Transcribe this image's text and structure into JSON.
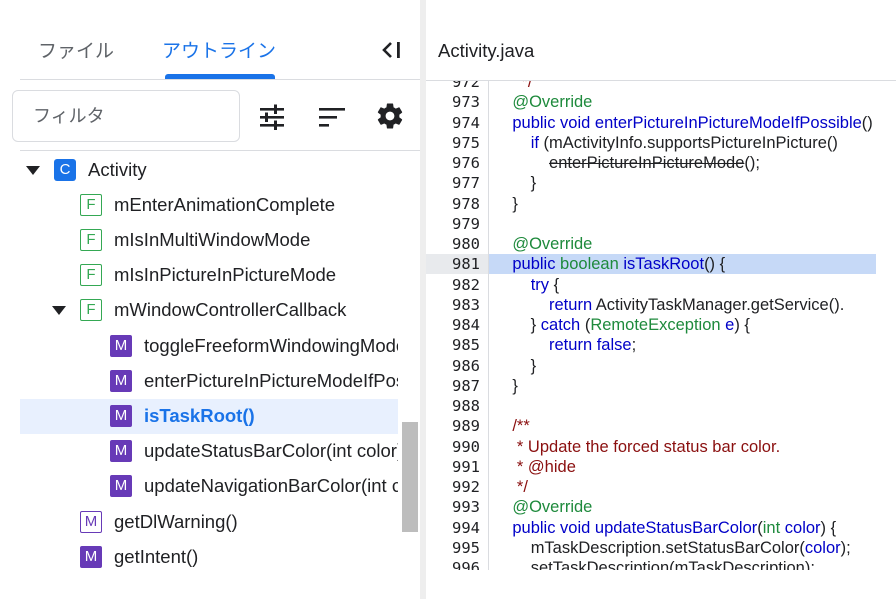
{
  "tabs": {
    "file": "ファイル",
    "outline": "アウトライン"
  },
  "filter": {
    "placeholder": "フィルタ"
  },
  "icons": {
    "collapse": "collapse-panel-icon",
    "tune": "tune-icon",
    "sort": "sort-icon",
    "gear": "gear-icon"
  },
  "colors": {
    "accent": "#1a73e8",
    "field": "#34a853",
    "method": "#673ab7",
    "selection": "#e8f0fe",
    "highlight": "#c6d9f7"
  },
  "tree": [
    {
      "label": "Activity",
      "badge": "C",
      "kind": "class",
      "indent": 0,
      "expanded": true
    },
    {
      "label": "mEnterAnimationComplete",
      "badge": "F",
      "kind": "field",
      "indent": 1
    },
    {
      "label": "mIsInMultiWindowMode",
      "badge": "F",
      "kind": "field",
      "indent": 1
    },
    {
      "label": "mIsInPictureInPictureMode",
      "badge": "F",
      "kind": "field",
      "indent": 1
    },
    {
      "label": "mWindowControllerCallback",
      "badge": "F",
      "kind": "field",
      "indent": 1,
      "expanded": true
    },
    {
      "label": "toggleFreeformWindowingMode",
      "badge": "M",
      "kind": "method",
      "indent": 2
    },
    {
      "label": "enterPictureInPictureModeIfPossible",
      "badge": "M",
      "kind": "method",
      "indent": 2
    },
    {
      "label": "isTaskRoot()",
      "badge": "M",
      "kind": "method",
      "indent": 2,
      "selected": true
    },
    {
      "label": "updateStatusBarColor(int color)",
      "badge": "M",
      "kind": "method",
      "indent": 2
    },
    {
      "label": "updateNavigationBarColor(int color)",
      "badge": "M",
      "kind": "method",
      "indent": 2
    },
    {
      "label": "getDlWarning()",
      "badge": "M",
      "kind": "method-outline",
      "indent": 1
    },
    {
      "label": "getIntent()",
      "badge": "M",
      "kind": "method",
      "indent": 1
    }
  ],
  "editor": {
    "title": "Activity.java",
    "highlight_line": "981",
    "lines": [
      {
        "n": "972",
        "parts": [
          [
            "      */",
            "cm"
          ]
        ]
      },
      {
        "n": "973",
        "parts": [
          [
            "    ",
            ""
          ],
          [
            "@Override",
            "an"
          ]
        ]
      },
      {
        "n": "974",
        "parts": [
          [
            "    ",
            ""
          ],
          [
            "public void ",
            "kw"
          ],
          [
            "enterPictureInPictureModeIfPossible",
            "fn"
          ],
          [
            "() {",
            ""
          ]
        ]
      },
      {
        "n": "975",
        "parts": [
          [
            "        ",
            ""
          ],
          [
            "if ",
            "kw"
          ],
          [
            "(mActivityInfo.supportsPictureInPicture()",
            ""
          ]
        ]
      },
      {
        "n": "976",
        "parts": [
          [
            "            ",
            ""
          ],
          [
            "enterPictureInPictureMode",
            "st"
          ],
          [
            "();",
            ""
          ]
        ]
      },
      {
        "n": "977",
        "parts": [
          [
            "        }",
            ""
          ]
        ]
      },
      {
        "n": "978",
        "parts": [
          [
            "    }",
            ""
          ]
        ]
      },
      {
        "n": "979",
        "parts": [
          [
            "",
            ""
          ]
        ]
      },
      {
        "n": "980",
        "parts": [
          [
            "    ",
            ""
          ],
          [
            "@Override",
            "an"
          ]
        ]
      },
      {
        "n": "981",
        "parts": [
          [
            "    ",
            ""
          ],
          [
            "public ",
            "kw"
          ],
          [
            "boolean ",
            "ty"
          ],
          [
            "isTaskRoot",
            "fn"
          ],
          [
            "() {",
            ""
          ]
        ]
      },
      {
        "n": "982",
        "parts": [
          [
            "        ",
            ""
          ],
          [
            "try ",
            "kw"
          ],
          [
            "{",
            ""
          ]
        ]
      },
      {
        "n": "983",
        "parts": [
          [
            "            ",
            ""
          ],
          [
            "return ",
            "kw"
          ],
          [
            "ActivityTaskManager.getService().",
            ""
          ]
        ]
      },
      {
        "n": "984",
        "parts": [
          [
            "        } ",
            ""
          ],
          [
            "catch ",
            "kw"
          ],
          [
            "(",
            ""
          ],
          [
            "RemoteException ",
            "ty"
          ],
          [
            "e",
            "fn"
          ],
          [
            ") {",
            ""
          ]
        ]
      },
      {
        "n": "985",
        "parts": [
          [
            "            ",
            ""
          ],
          [
            "return false",
            "kw"
          ],
          [
            ";",
            ""
          ]
        ]
      },
      {
        "n": "986",
        "parts": [
          [
            "        }",
            ""
          ]
        ]
      },
      {
        "n": "987",
        "parts": [
          [
            "    }",
            ""
          ]
        ]
      },
      {
        "n": "988",
        "parts": [
          [
            "",
            ""
          ]
        ]
      },
      {
        "n": "989",
        "parts": [
          [
            "    ",
            ""
          ],
          [
            "/**",
            "cm"
          ]
        ]
      },
      {
        "n": "990",
        "parts": [
          [
            "     ",
            ""
          ],
          [
            "* Update the forced status bar color.",
            "cm"
          ]
        ]
      },
      {
        "n": "991",
        "parts": [
          [
            "     ",
            ""
          ],
          [
            "* @hide",
            "cm"
          ]
        ]
      },
      {
        "n": "992",
        "parts": [
          [
            "     ",
            ""
          ],
          [
            "*/",
            "cm"
          ]
        ]
      },
      {
        "n": "993",
        "parts": [
          [
            "    ",
            ""
          ],
          [
            "@Override",
            "an"
          ]
        ]
      },
      {
        "n": "994",
        "parts": [
          [
            "    ",
            ""
          ],
          [
            "public void ",
            "kw"
          ],
          [
            "updateStatusBarColor",
            "fn"
          ],
          [
            "(",
            ""
          ],
          [
            "int ",
            "ty"
          ],
          [
            "color",
            "fn"
          ],
          [
            ") {",
            ""
          ]
        ]
      },
      {
        "n": "995",
        "parts": [
          [
            "        ",
            ""
          ],
          [
            "mTaskDescription.setStatusBarColor(",
            ""
          ],
          [
            "color",
            "fn"
          ],
          [
            ");",
            ""
          ]
        ]
      },
      {
        "n": "996",
        "parts": [
          [
            "        ",
            ""
          ],
          [
            "setTaskDescription(mTaskDescription);",
            ""
          ]
        ]
      }
    ]
  }
}
